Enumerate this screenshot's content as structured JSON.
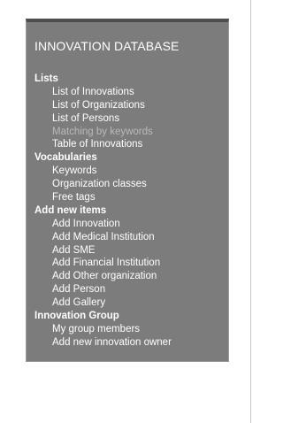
{
  "sidebar": {
    "title": "INNOVATION DATABASE",
    "groups": [
      {
        "label": "Lists",
        "items": [
          {
            "label": "List of Innovations",
            "disabled": false
          },
          {
            "label": "List of Organizations",
            "disabled": false
          },
          {
            "label": "List of Persons",
            "disabled": false
          },
          {
            "label": "Matching by keywords",
            "disabled": true
          },
          {
            "label": "Table of Innovations",
            "disabled": false
          }
        ]
      },
      {
        "label": "Vocabularies",
        "items": [
          {
            "label": "Keywords",
            "disabled": false
          },
          {
            "label": "Organization classes",
            "disabled": false
          },
          {
            "label": "Free tags",
            "disabled": false
          }
        ]
      },
      {
        "label": "Add new items",
        "items": [
          {
            "label": "Add Innovation",
            "disabled": false
          },
          {
            "label": "Add Medical Institution",
            "disabled": false
          },
          {
            "label": "Add SME",
            "disabled": false
          },
          {
            "label": "Add Financial Institution",
            "disabled": false
          },
          {
            "label": "Add Other organization",
            "disabled": false
          },
          {
            "label": "Add Person",
            "disabled": false
          },
          {
            "label": "Add Gallery",
            "disabled": false
          }
        ]
      },
      {
        "label": "Innovation Group",
        "items": [
          {
            "label": "My group members",
            "disabled": false
          },
          {
            "label": "Add new innovation owner",
            "disabled": false
          }
        ]
      }
    ]
  },
  "colors": {
    "panel_background": "#7c7c7c",
    "panel_top_border": "#4e4e4e",
    "text": "#ffffff",
    "disabled_text": "#b9b9b9"
  }
}
